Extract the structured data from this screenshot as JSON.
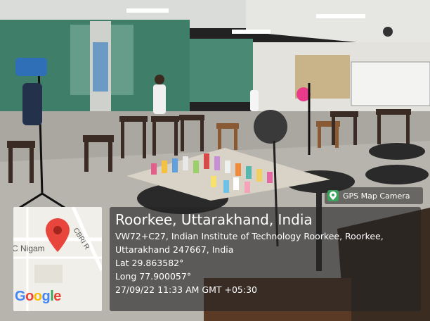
{
  "badge": {
    "text": "GPS Map Camera"
  },
  "map": {
    "road_label_1": "C Nigam",
    "road_label_2": "CBRI R",
    "logo_g": "G",
    "logo_o1": "o",
    "logo_o2": "o",
    "logo_g2": "g",
    "logo_l": "l",
    "logo_e": "e"
  },
  "location": {
    "title": "Roorkee, Uttarakhand, India",
    "address_line1": "VW72+C27, Indian Institute of Technology Roorkee, Roorkee,",
    "address_line2": "Uttarakhand 247667, India",
    "lat": "Lat 29.863582°",
    "long": "Long 77.900057°",
    "datetime": "27/09/22 11:33 AM GMT +05:30"
  },
  "colors": {
    "wall_green": "#3f7f6a",
    "pin_red": "#e8453c",
    "app_icon": "#3ba35c"
  }
}
